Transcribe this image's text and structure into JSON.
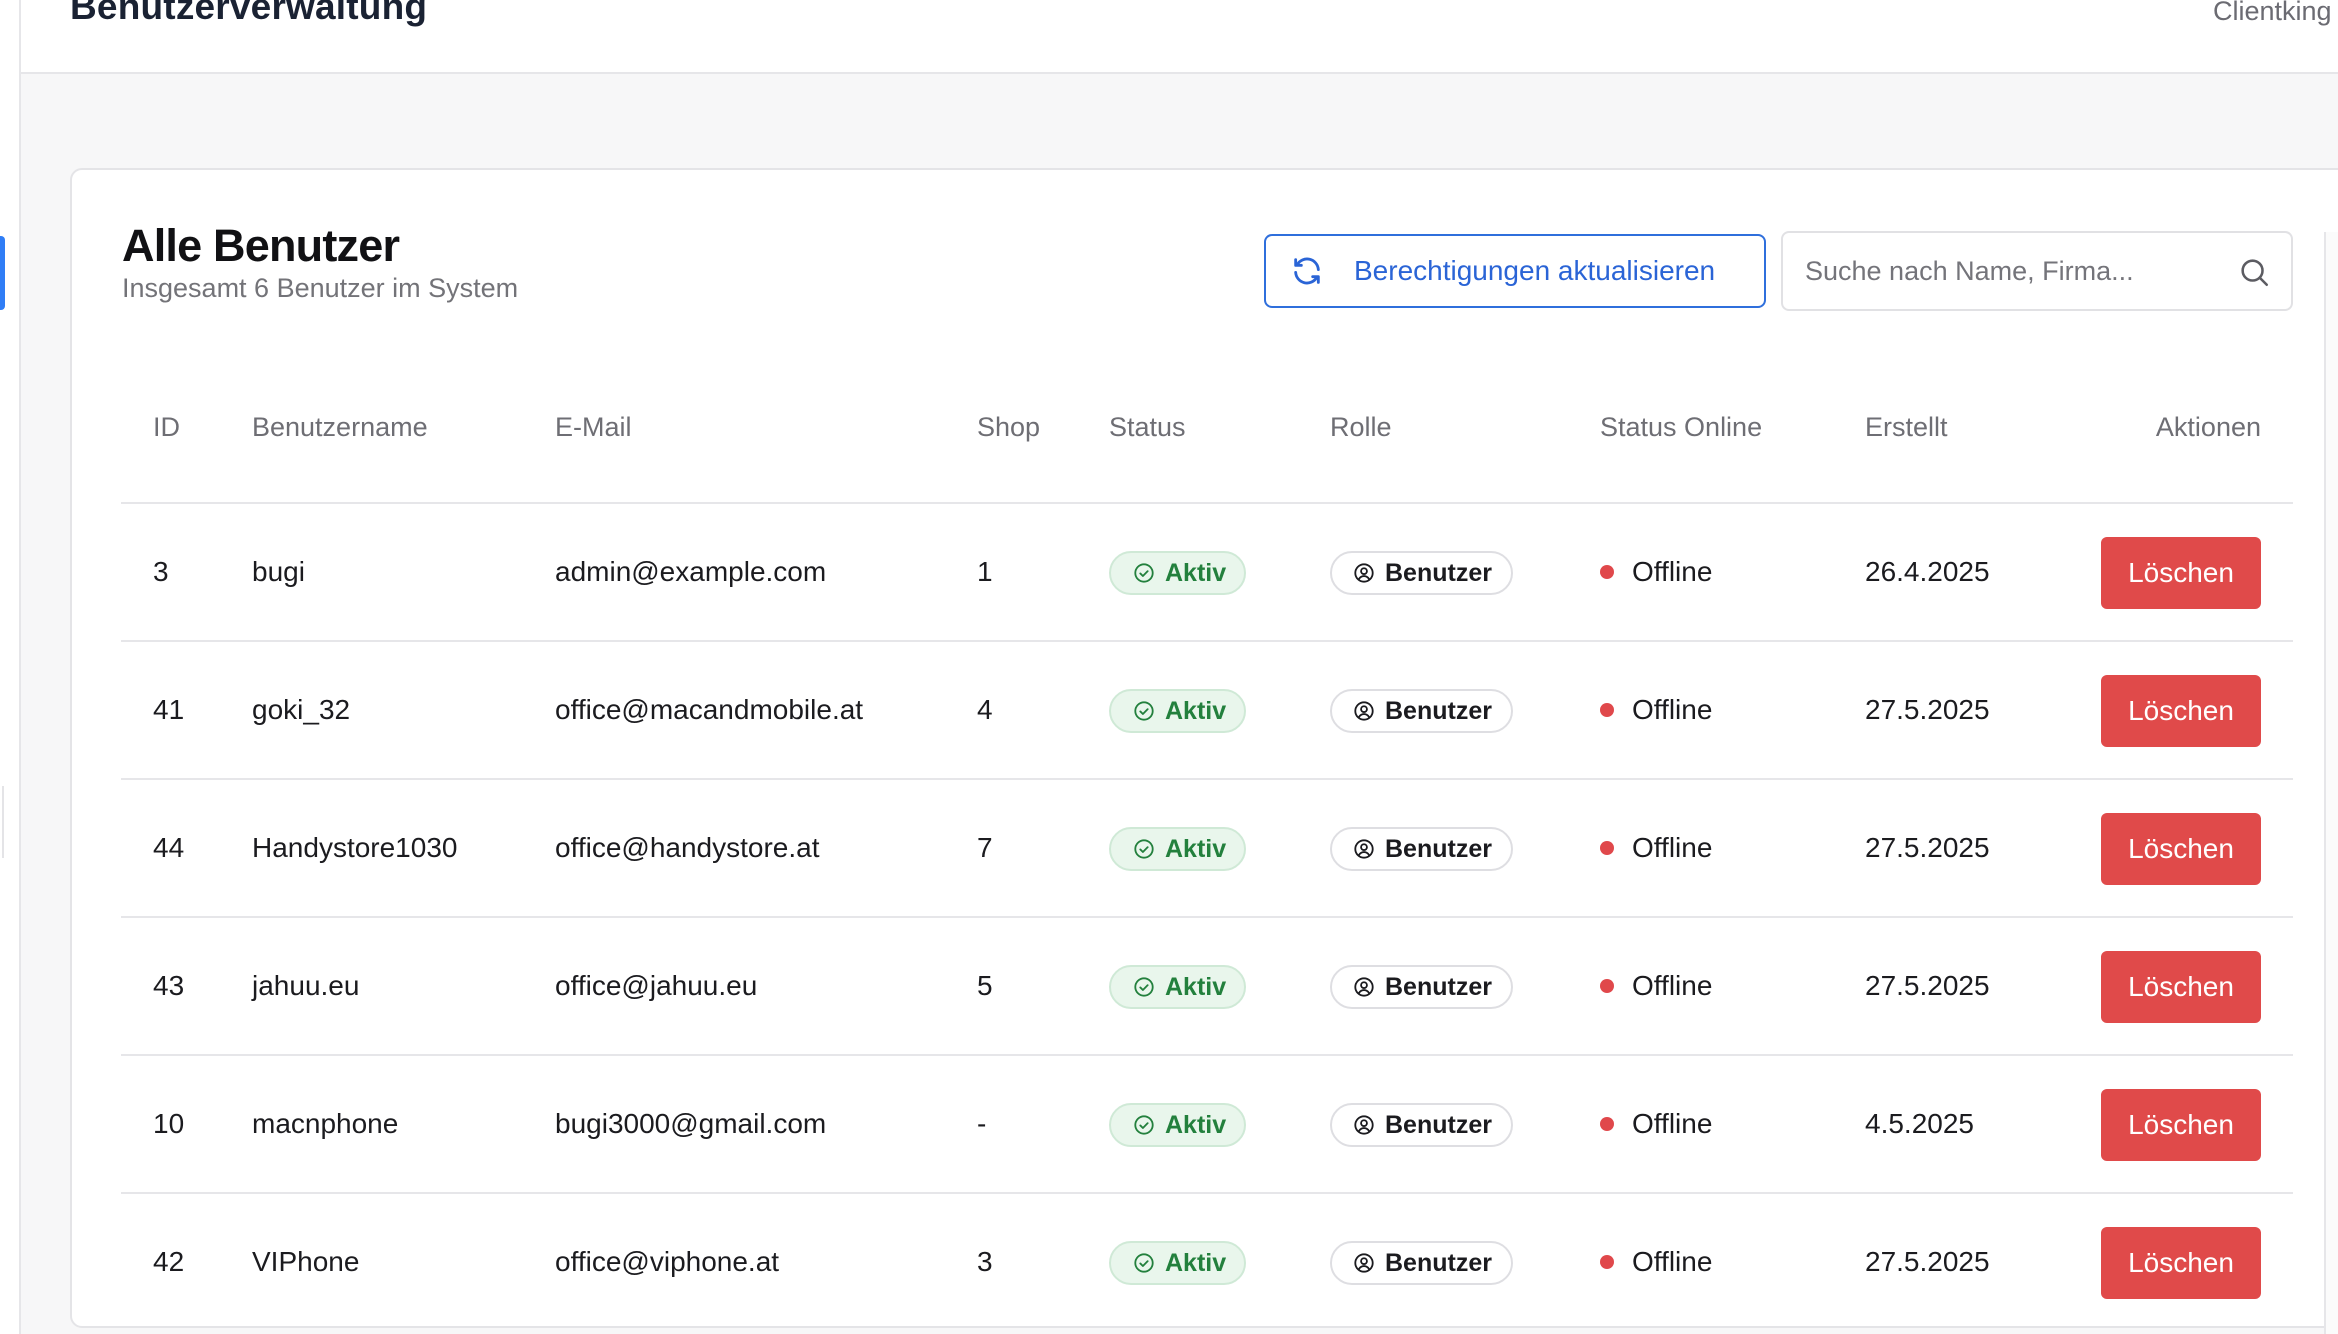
{
  "topbar": {
    "title": "Benutzerverwaltung",
    "right_text": "Clientking"
  },
  "card": {
    "title": "Alle Benutzer",
    "subtitle": "Insgesamt 6 Benutzer im System",
    "refresh_label": "Berechtigungen aktualisieren",
    "search_placeholder": "Suche nach Name, Firma..."
  },
  "table": {
    "headers": {
      "id": "ID",
      "username": "Benutzername",
      "email": "E-Mail",
      "shop": "Shop",
      "status": "Status",
      "role": "Rolle",
      "online": "Status Online",
      "created": "Erstellt",
      "actions": "Aktionen"
    },
    "rows": [
      {
        "id": "3",
        "username": "bugi",
        "email": "admin@example.com",
        "shop": "1",
        "status": "Aktiv",
        "role": "Benutzer",
        "online": "Offline",
        "created": "26.4.2025",
        "action": "Löschen"
      },
      {
        "id": "41",
        "username": "goki_32",
        "email": "office@macandmobile.at",
        "shop": "4",
        "status": "Aktiv",
        "role": "Benutzer",
        "online": "Offline",
        "created": "27.5.2025",
        "action": "Löschen"
      },
      {
        "id": "44",
        "username": "Handystore1030",
        "email": "office@handystore.at",
        "shop": "7",
        "status": "Aktiv",
        "role": "Benutzer",
        "online": "Offline",
        "created": "27.5.2025",
        "action": "Löschen"
      },
      {
        "id": "43",
        "username": "jahuu.eu",
        "email": "office@jahuu.eu",
        "shop": "5",
        "status": "Aktiv",
        "role": "Benutzer",
        "online": "Offline",
        "created": "27.5.2025",
        "action": "Löschen"
      },
      {
        "id": "10",
        "username": "macnphone",
        "email": "bugi3000@gmail.com",
        "shop": "-",
        "status": "Aktiv",
        "role": "Benutzer",
        "online": "Offline",
        "created": "4.5.2025",
        "action": "Löschen"
      },
      {
        "id": "42",
        "username": "VIPhone",
        "email": "office@viphone.at",
        "shop": "3",
        "status": "Aktiv",
        "role": "Benutzer",
        "online": "Offline",
        "created": "27.5.2025",
        "action": "Löschen"
      }
    ]
  },
  "colors": {
    "accent": "#2a64d6",
    "danger": "#e04a4a",
    "success": "#23803d",
    "offline_dot": "#e0484b"
  },
  "icons": {
    "refresh": "refresh-icon",
    "search": "search-icon",
    "status_active": "check-circle-icon",
    "role": "user-circle-icon",
    "online": "status-dot-icon"
  }
}
